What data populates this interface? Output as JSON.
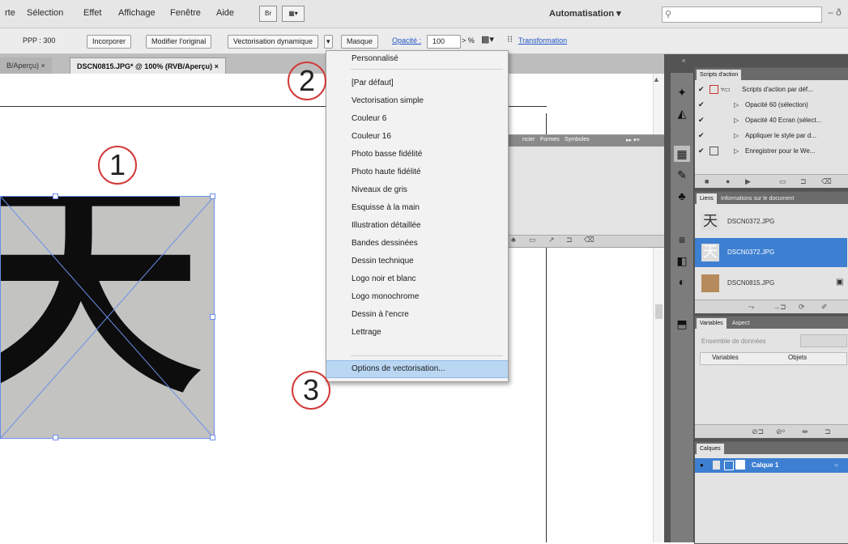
{
  "menubar": {
    "items": [
      "rte",
      "Sélection",
      "Effet",
      "Affichage",
      "Fenêtre",
      "Aide"
    ],
    "bridge_icon": "Br",
    "arrange_icon": "arrange-documents-icon",
    "workspace": "Automatisation ▾",
    "window_controls": "– ð"
  },
  "controlbar": {
    "ppp": "PPP : 300",
    "incorporer": "Incorporer",
    "modifier": "Modifier l'original",
    "vectorisation": "Vectorisation dynamique",
    "masque": "Masque",
    "opacite_label": "Opacité :",
    "opacite_value": "100",
    "percent": "> %",
    "transformation": "Transformation"
  },
  "tabs": [
    {
      "label": "B/Aperçu)  ×"
    },
    {
      "label": "DSCN0815.JPG* @ 100% (RVB/Aperçu)  ×"
    }
  ],
  "canvas": {
    "kanji": "天",
    "callouts": [
      "1",
      "2",
      "3"
    ]
  },
  "float_panel": {
    "tabs": [
      "ncier",
      "Formes",
      "Symboles"
    ],
    "arrows": "▸▸ ▾≡"
  },
  "dropdown": {
    "items": [
      "Personnalisé",
      "[Par défaut]",
      "Vectorisation simple",
      "Couleur 6",
      "Couleur 16",
      "Photo basse fidélité",
      "Photo haute fidélité",
      "Niveaux de gris",
      "Esquisse à la main",
      "Illustration détaillée",
      "Bandes dessinées",
      "Dessin technique",
      "Logo noir et blanc",
      "Logo monochrome",
      "Dessin à l'encre",
      "Lettrage"
    ],
    "options": "Options de vectorisation...",
    "highlight_color": "#b9d6f3"
  },
  "actions_panel": {
    "tab": "Scripts d'action",
    "rows": [
      "Scripts d'action par déf...",
      "Opacité 60 (sélection)",
      "Opacité 40 Ecran (sélect...",
      "Appliquer le style par d...",
      "Enregistrer pour le We..."
    ]
  },
  "links_panel": {
    "tabs": [
      "Liens",
      "Informations sur le document"
    ],
    "items": [
      {
        "name": "DSCN0372.JPG",
        "thumb": "天"
      },
      {
        "name": "DSCN0372.JPG",
        "thumb": "天"
      },
      {
        "name": "DSCN0815.JPG",
        "thumb": ""
      }
    ],
    "selected_color": "#3d7fd1"
  },
  "variables_panel": {
    "tabs": [
      "Variables",
      "Aspect"
    ],
    "dataset_label": "Ensemble de données",
    "col_variables": "Variables",
    "col_objets": "Objets"
  },
  "layers_panel": {
    "tab": "Calques",
    "layer": "Calque 1"
  },
  "accent_callout": "#d23a3a",
  "selection_color": "#6c8ee8"
}
